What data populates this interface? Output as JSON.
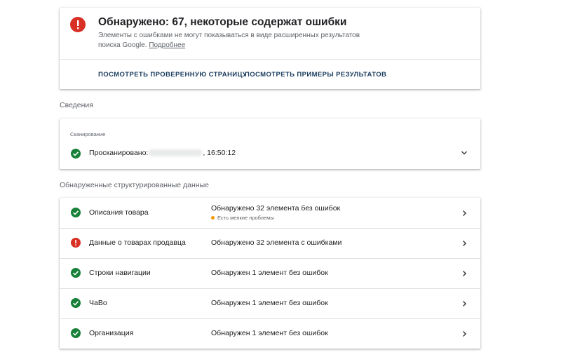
{
  "summary": {
    "title": "Обнаружено: 67, некоторые содержат ошибки",
    "description": "Элементы с ошибками не могут показываться в виде расширенных результатов поиска Google.",
    "learn_more": "Подробнее",
    "actions": {
      "view_tested_page": "ПОСМОТРЕТЬ ПРОВЕРЕННУЮ СТРАНИЦУ",
      "view_result_examples": "ПОСМОТРЕТЬ ПРИМЕРЫ РЕЗУЛЬТАТОВ"
    }
  },
  "details": {
    "section_title": "Сведения",
    "crawl": {
      "label": "Сканирование",
      "text": "Просканировано:",
      "time": ", 16:50:12"
    }
  },
  "detected": {
    "section_title": "Обнаруженные структурированные данные",
    "items": [
      {
        "name": "Описания товара",
        "status": "ok",
        "result": "Обнаружено 32 элемента без ошибок",
        "note": "Есть мелкие проблемы",
        "note_color": "#f29900"
      },
      {
        "name": "Данные о товарах продавца",
        "status": "error",
        "result": "Обнаружено 32 элемента с ошибками"
      },
      {
        "name": "Строки навигации",
        "status": "ok",
        "result": "Обнаружен 1 элемент без ошибок"
      },
      {
        "name": "ЧаВо",
        "status": "ok",
        "result": "Обнаружен 1 элемент без ошибок"
      },
      {
        "name": "Организация",
        "status": "ok",
        "result": "Обнаружен 1 элемент без ошибок"
      }
    ]
  },
  "icons": {
    "ok": "check-circle-icon",
    "error": "error-exclamation-icon",
    "expand": "chevron-down-icon",
    "open": "chevron-right-icon"
  },
  "colors": {
    "ok": "#188038",
    "error": "#d93025",
    "warning": "#f29900",
    "action": "#1a3c5e"
  }
}
